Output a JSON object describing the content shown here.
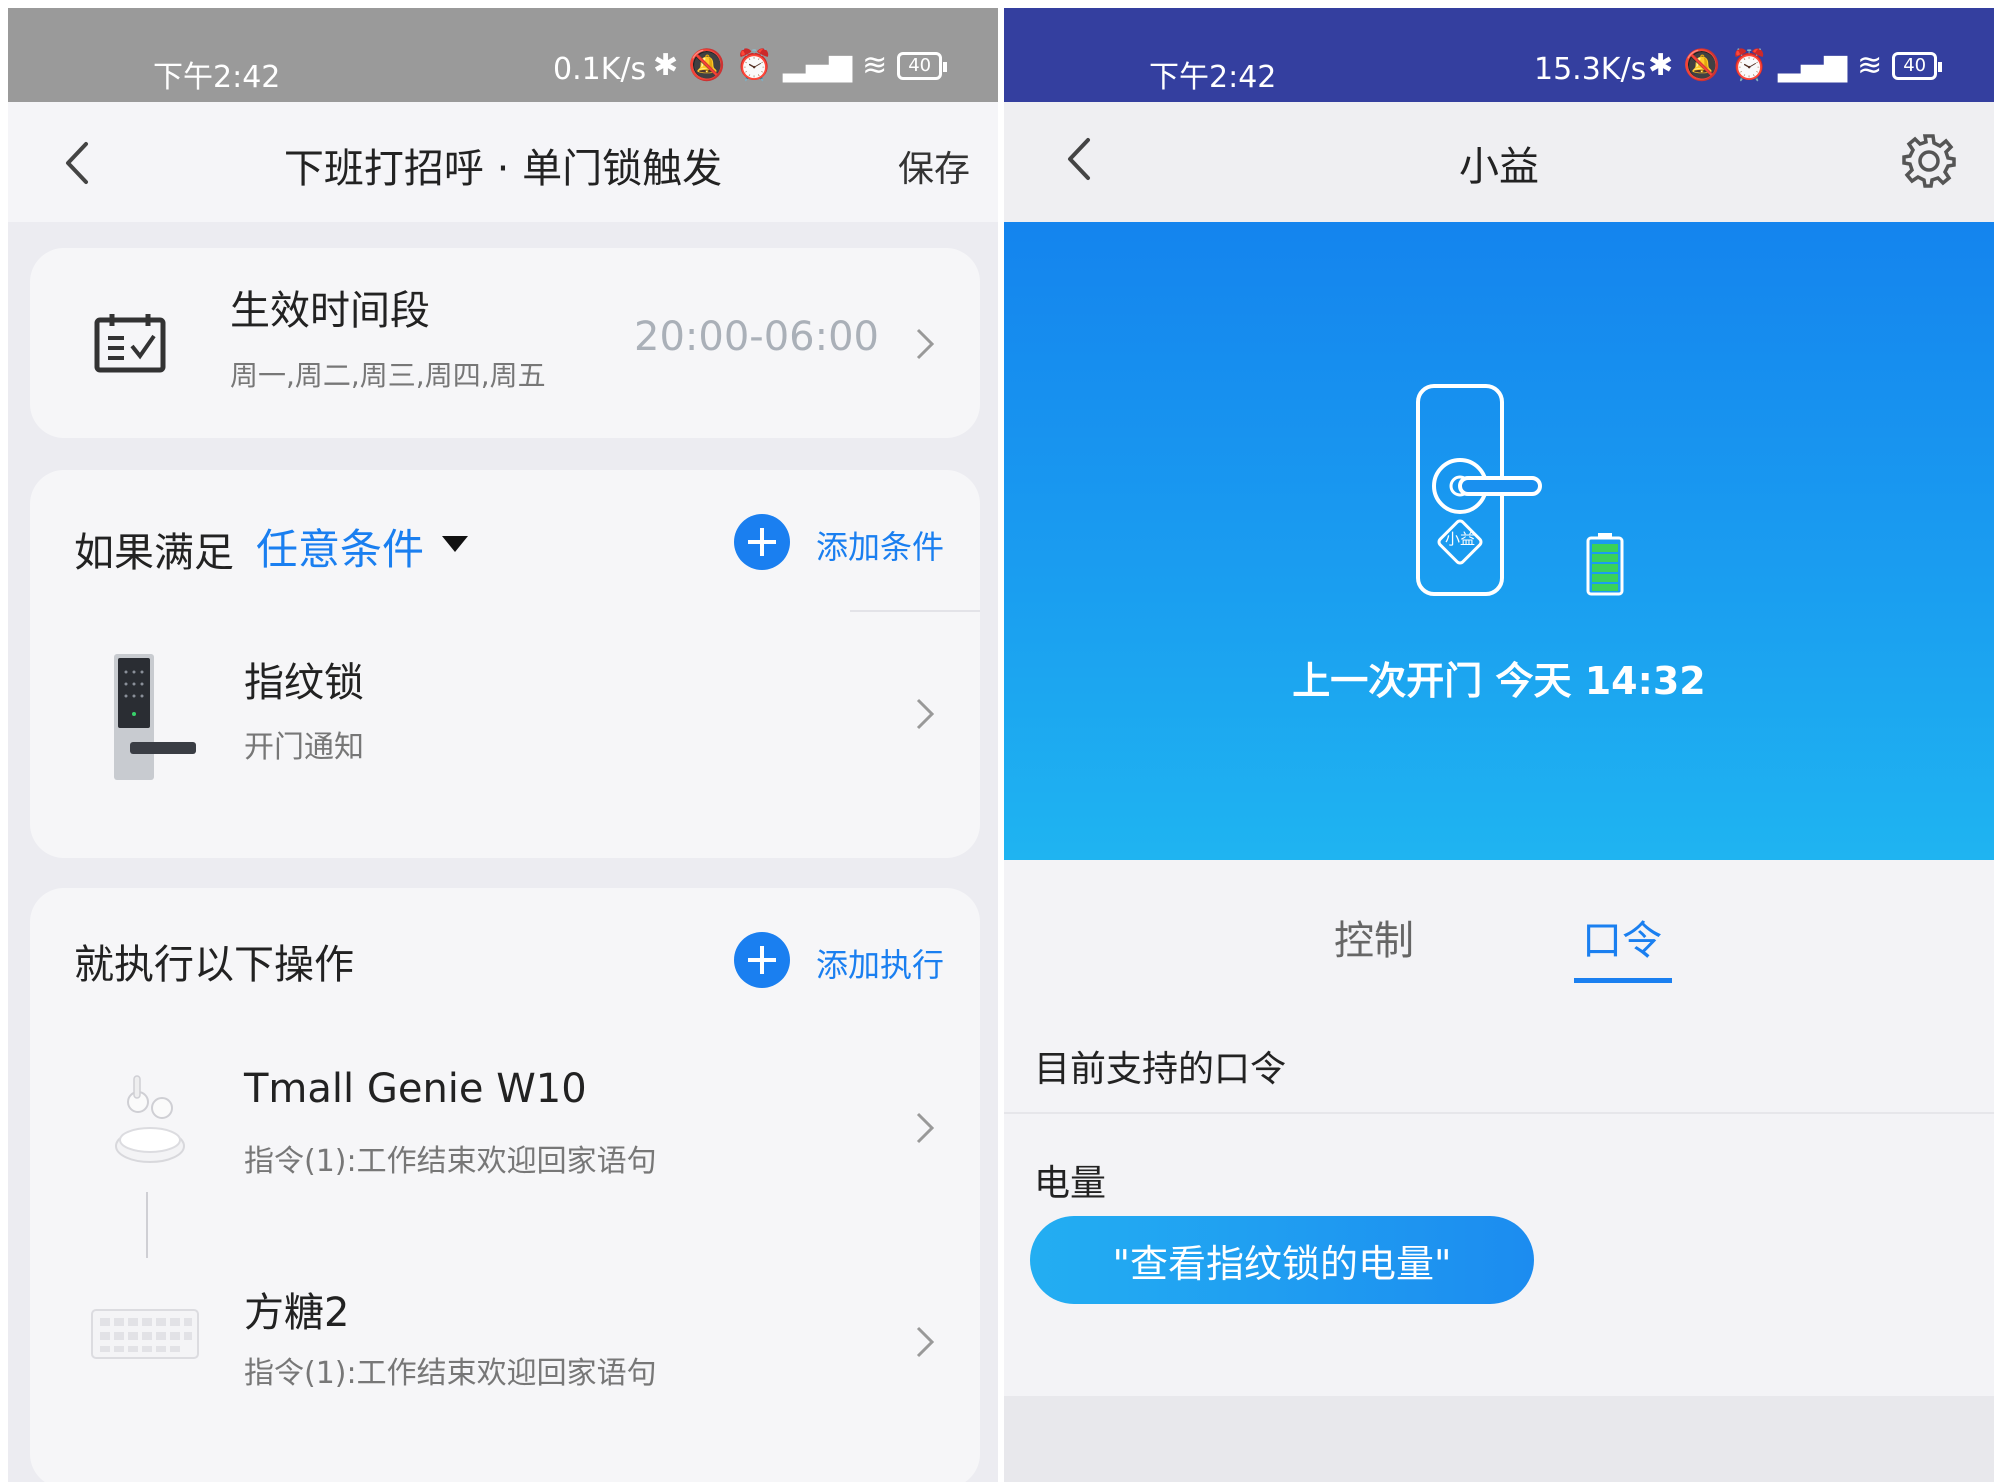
{
  "left": {
    "status": {
      "time": "下午2:42",
      "speed": "0.1K/s",
      "battery": "40"
    },
    "header": {
      "title": "下班打招呼 · 单门锁触发",
      "save_label": "保存"
    },
    "schedule": {
      "title": "生效时间段",
      "days": "周一,周二,周三,周四,周五",
      "time_range": "20:00-06:00"
    },
    "conditions": {
      "if_label": "如果满足",
      "mode": "任意条件",
      "add_label": "添加条件",
      "items": [
        {
          "name": "指纹锁",
          "detail": "开门通知"
        }
      ]
    },
    "actions": {
      "title": "就执行以下操作",
      "add_label": "添加执行",
      "items": [
        {
          "name": "Tmall Genie W10",
          "detail": "指令(1):工作结束欢迎回家语句"
        },
        {
          "name": "方糖2",
          "detail": "指令(1):工作结束欢迎回家语句"
        }
      ]
    }
  },
  "right": {
    "status": {
      "time": "下午2:42",
      "speed": "15.3K/s",
      "battery": "40"
    },
    "header": {
      "title": "小益"
    },
    "device": {
      "badge": "小益",
      "last_open": "上一次开门 今天 14:32",
      "load_progress": 0.7
    },
    "tabs": [
      {
        "label": "控制",
        "active": false
      },
      {
        "label": "口令",
        "active": true
      }
    ],
    "commands": {
      "supported_label": "目前支持的口令",
      "battery_label": "电量",
      "battery_command": "\"查看指纹锁的电量\""
    }
  },
  "colors": {
    "accent": "#1a7ff0",
    "hero_top": "#1484ee",
    "hero_bottom": "#1fb4f1"
  }
}
